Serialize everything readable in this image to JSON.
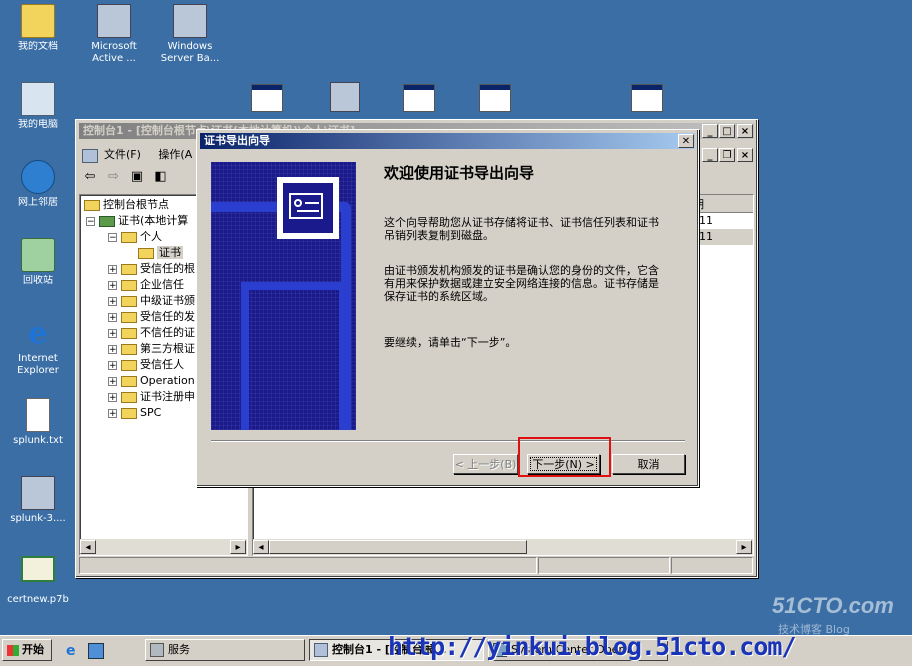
{
  "desktop": {
    "icons": [
      {
        "label": "我的文档"
      },
      {
        "label": "Microsoft Active ..."
      },
      {
        "label": "Windows Server Ba..."
      },
      {
        "label": "我的电脑"
      },
      {
        "label": "网上邻居"
      },
      {
        "label": "回收站"
      },
      {
        "label": "Internet Explorer"
      },
      {
        "label": "splunk.txt"
      },
      {
        "label": "splunk-3...."
      },
      {
        "label": "certnew.p7b"
      }
    ]
  },
  "console": {
    "title": "控制台1 - [控制台根节点\\证书(本地计算机)\\个人\\证书]",
    "menu": [
      "文件(F)",
      "操作(A"
    ],
    "tree": {
      "root": "控制台根节点",
      "store": "证书(本地计算",
      "personal": "个人",
      "certs": "证书",
      "items": [
        "受信任的根",
        "企业信任",
        "中级证书颁",
        "受信任的发",
        "不信任的证",
        "第三方根证",
        "受信任人",
        "Operation",
        "证书注册申",
        "SPC"
      ]
    },
    "list": {
      "header_fragment": "期",
      "rows": [
        "11",
        "11"
      ]
    }
  },
  "wizard": {
    "title": "证书导出向导",
    "heading": "欢迎使用证书导出向导",
    "para1": "这个向导帮助您从证书存储将证书、证书信任列表和证书吊销列表复制到磁盘。",
    "para2": "由证书颁发机构颁发的证书是确认您的身份的文件，它含有用来保护数据或建立安全网络连接的信息。证书存储是保存证书的系统区域。",
    "para3": "要继续，请单击“下一步”。",
    "back_button": "< 上一步(B)",
    "next_button": "下一步(N) >",
    "cancel_button": "取消",
    "close_glyph": "✕"
  },
  "taskbar": {
    "start": "开始",
    "buttons": [
      "服务",
      "控制台1 - [控制台根...",
      "System Center Opera..."
    ]
  },
  "watermark": {
    "site": "51CTO.com",
    "blog": "技术博客 Blog",
    "url": "http://yinkui.blog.51cto.com/"
  },
  "colors": {
    "desktop": "#3a6ea5",
    "title_active": "#0a246a",
    "highlight_box": "#e01010"
  }
}
